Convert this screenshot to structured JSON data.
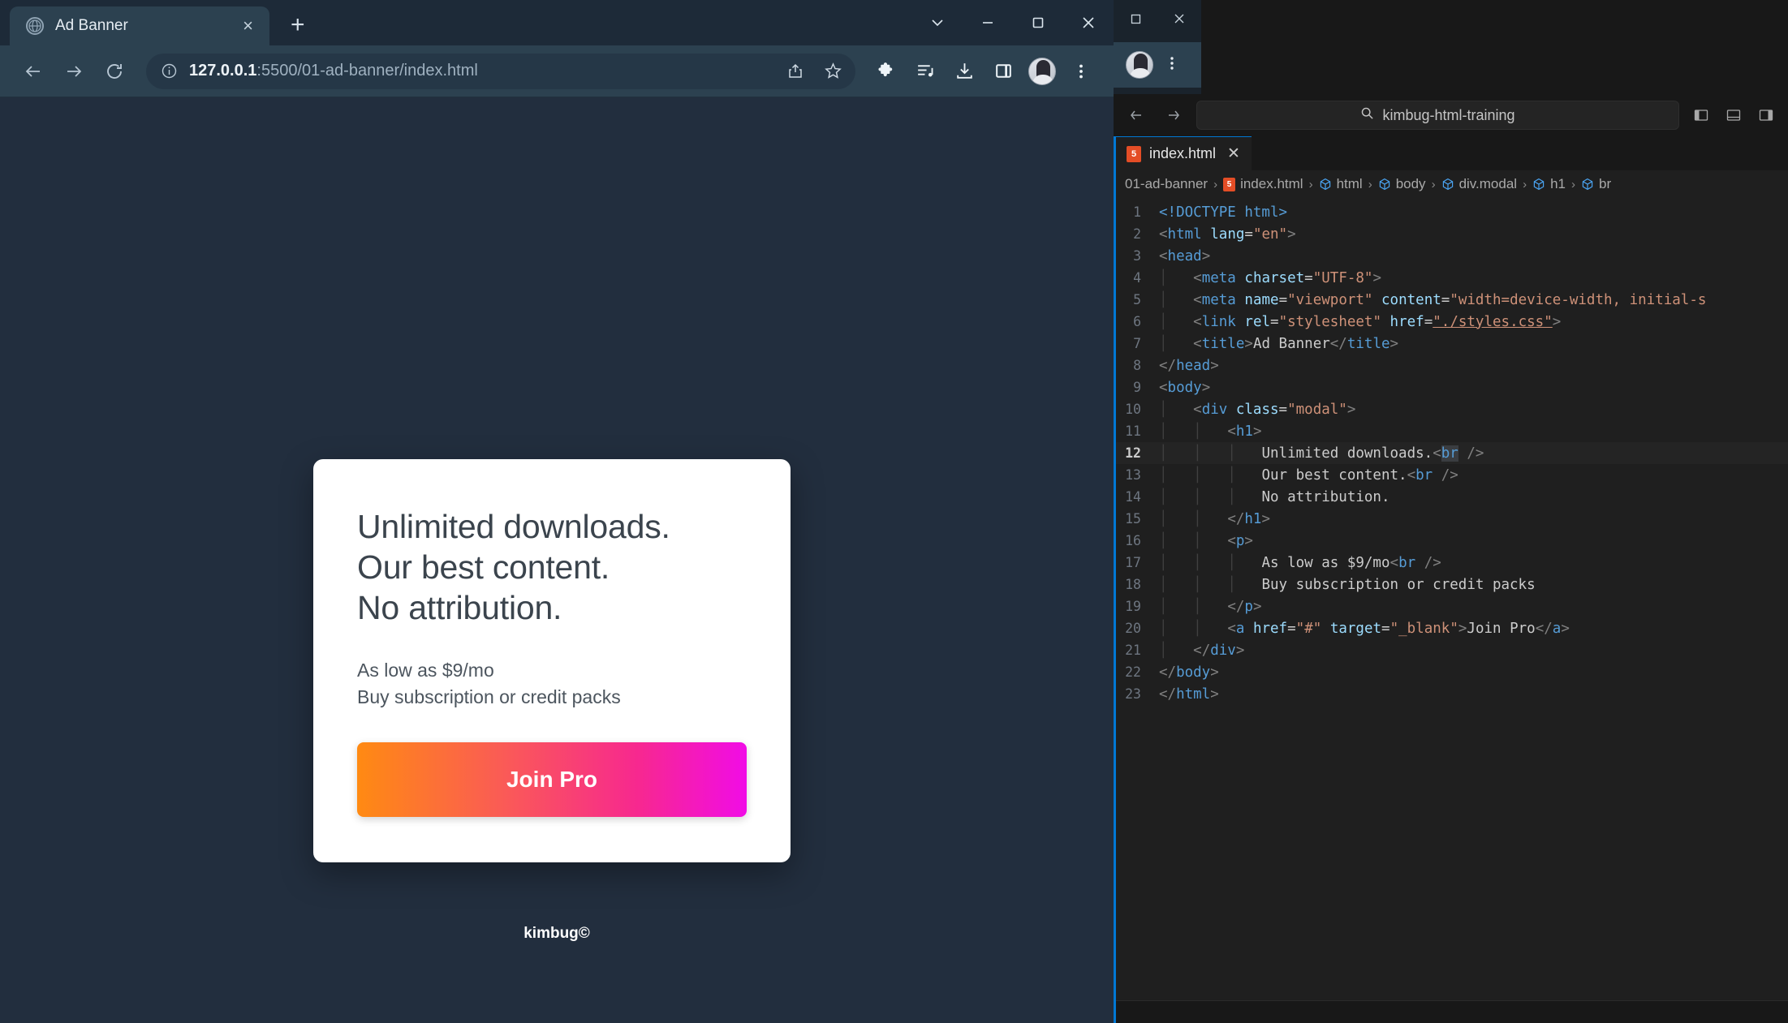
{
  "browser": {
    "tab": {
      "title": "Ad Banner",
      "favicon": "globe-icon",
      "close": "×"
    },
    "new_tab_label": "+",
    "window_controls": {
      "minimize": "–",
      "maximize": "□",
      "close": "✕",
      "tab_search": "⌄"
    },
    "toolbar": {
      "back": "back-arrow-icon",
      "forward": "forward-arrow-icon",
      "reload": "reload-icon",
      "url_prefix": "127.0.0.1",
      "url_suffix": ":5500/01-ad-banner/index.html",
      "url_full": "127.0.0.1:5500/01-ad-banner/index.html",
      "info_icon": "site-info-icon",
      "share_icon": "share-icon",
      "bookmark_icon": "star-icon",
      "extensions_icon": "puzzle-icon",
      "reading_list_icon": "media-list-icon",
      "downloads_icon": "download-icon",
      "side_panel_icon": "side-panel-icon",
      "profile_icon": "avatar",
      "menu_icon": "kebab-menu-icon"
    }
  },
  "page": {
    "heading_line1": "Unlimited downloads.",
    "heading_line2": "Our best content.",
    "heading_line3": "No attribution.",
    "sub_line1": "As low as $9/mo",
    "sub_line2": "Buy subscription or credit packs",
    "cta_label": "Join Pro",
    "credit": "kimbug©",
    "colors": {
      "background": "#222e3e",
      "card": "#ffffff",
      "cta_gradient_start": "#ff8a12",
      "cta_gradient_end": "#f10ce6",
      "heading_text": "#3b444d"
    }
  },
  "vscode": {
    "window_controls": {
      "restore": "❐",
      "close": "✕"
    },
    "profile_icon": "avatar",
    "more_icon": "kebab-menu-icon",
    "quick_input": {
      "value": "kimbug-html-training",
      "search_icon": "search-icon"
    },
    "back_forward": {
      "back": "←",
      "forward": "→"
    },
    "layout_icons": [
      "toggle-primary-sidebar-icon",
      "toggle-panel-icon",
      "toggle-secondary-sidebar-icon"
    ],
    "tab": {
      "label": "index.html",
      "icon": "html5-icon",
      "icon_text": "5",
      "close": "✕"
    },
    "breadcrumb": [
      {
        "label": "01-ad-banner",
        "icon": "none"
      },
      {
        "label": "index.html",
        "icon": "html5-icon"
      },
      {
        "label": "html",
        "icon": "symbol-cube-icon"
      },
      {
        "label": "body",
        "icon": "symbol-cube-icon"
      },
      {
        "label": "div.modal",
        "icon": "symbol-cube-icon"
      },
      {
        "label": "h1",
        "icon": "symbol-cube-icon"
      },
      {
        "label": "br",
        "icon": "symbol-cube-icon"
      }
    ],
    "breadcrumb_separator": "›",
    "active_line": 12,
    "code": [
      {
        "n": 1,
        "indent": 0,
        "tokens": [
          [
            "t-doctype",
            "<!DOCTYPE "
          ],
          [
            "t-tag",
            "html"
          ],
          [
            "t-doctype",
            ">"
          ]
        ]
      },
      {
        "n": 2,
        "indent": 0,
        "tokens": [
          [
            "t-punc",
            "<"
          ],
          [
            "t-tag",
            "html"
          ],
          [
            "t-txt",
            " "
          ],
          [
            "t-attr",
            "lang"
          ],
          [
            "t-txt",
            "="
          ],
          [
            "t-str",
            "\"en\""
          ],
          [
            "t-punc",
            ">"
          ]
        ]
      },
      {
        "n": 3,
        "indent": 0,
        "tokens": [
          [
            "t-punc",
            "<"
          ],
          [
            "t-tag",
            "head"
          ],
          [
            "t-punc",
            ">"
          ]
        ]
      },
      {
        "n": 4,
        "indent": 1,
        "tokens": [
          [
            "t-punc",
            "<"
          ],
          [
            "t-tag",
            "meta"
          ],
          [
            "t-txt",
            " "
          ],
          [
            "t-attr",
            "charset"
          ],
          [
            "t-txt",
            "="
          ],
          [
            "t-str",
            "\"UTF-8\""
          ],
          [
            "t-punc",
            ">"
          ]
        ]
      },
      {
        "n": 5,
        "indent": 1,
        "tokens": [
          [
            "t-punc",
            "<"
          ],
          [
            "t-tag",
            "meta"
          ],
          [
            "t-txt",
            " "
          ],
          [
            "t-attr",
            "name"
          ],
          [
            "t-txt",
            "="
          ],
          [
            "t-str",
            "\"viewport\""
          ],
          [
            "t-txt",
            " "
          ],
          [
            "t-attr",
            "content"
          ],
          [
            "t-txt",
            "="
          ],
          [
            "t-str",
            "\"width=device-width, initial-s"
          ]
        ]
      },
      {
        "n": 6,
        "indent": 1,
        "tokens": [
          [
            "t-punc",
            "<"
          ],
          [
            "t-tag",
            "link"
          ],
          [
            "t-txt",
            " "
          ],
          [
            "t-attr",
            "rel"
          ],
          [
            "t-txt",
            "="
          ],
          [
            "t-str",
            "\"stylesheet\""
          ],
          [
            "t-txt",
            " "
          ],
          [
            "t-attr",
            "href"
          ],
          [
            "t-txt",
            "="
          ],
          [
            "t-str underline-link",
            "\"./styles.css\""
          ],
          [
            "t-punc",
            ">"
          ]
        ]
      },
      {
        "n": 7,
        "indent": 1,
        "tokens": [
          [
            "t-punc",
            "<"
          ],
          [
            "t-tag",
            "title"
          ],
          [
            "t-punc",
            ">"
          ],
          [
            "t-txt",
            "Ad Banner"
          ],
          [
            "t-punc",
            "</"
          ],
          [
            "t-tag",
            "title"
          ],
          [
            "t-punc",
            ">"
          ]
        ]
      },
      {
        "n": 8,
        "indent": 0,
        "tokens": [
          [
            "t-punc",
            "</"
          ],
          [
            "t-tag",
            "head"
          ],
          [
            "t-punc",
            ">"
          ]
        ]
      },
      {
        "n": 9,
        "indent": 0,
        "tokens": [
          [
            "t-punc",
            "<"
          ],
          [
            "t-tag",
            "body"
          ],
          [
            "t-punc",
            ">"
          ]
        ]
      },
      {
        "n": 10,
        "indent": 1,
        "tokens": [
          [
            "t-punc",
            "<"
          ],
          [
            "t-tag",
            "div"
          ],
          [
            "t-txt",
            " "
          ],
          [
            "t-attr",
            "class"
          ],
          [
            "t-txt",
            "="
          ],
          [
            "t-str",
            "\"modal\""
          ],
          [
            "t-punc",
            ">"
          ]
        ]
      },
      {
        "n": 11,
        "indent": 2,
        "tokens": [
          [
            "t-punc",
            "<"
          ],
          [
            "t-tag",
            "h1"
          ],
          [
            "t-punc",
            ">"
          ]
        ]
      },
      {
        "n": 12,
        "indent": 3,
        "tokens": [
          [
            "t-txt",
            "Unlimited downloads."
          ],
          [
            "t-punc",
            "<"
          ],
          [
            "sel t-tag",
            "br"
          ],
          [
            "t-txt",
            " "
          ],
          [
            "t-punc",
            "/>"
          ]
        ]
      },
      {
        "n": 13,
        "indent": 3,
        "tokens": [
          [
            "t-txt",
            "Our best content."
          ],
          [
            "t-punc",
            "<"
          ],
          [
            "t-tag",
            "br"
          ],
          [
            "t-txt",
            " "
          ],
          [
            "t-punc",
            "/>"
          ]
        ]
      },
      {
        "n": 14,
        "indent": 3,
        "tokens": [
          [
            "t-txt",
            "No attribution."
          ]
        ]
      },
      {
        "n": 15,
        "indent": 2,
        "tokens": [
          [
            "t-punc",
            "</"
          ],
          [
            "t-tag",
            "h1"
          ],
          [
            "t-punc",
            ">"
          ]
        ]
      },
      {
        "n": 16,
        "indent": 2,
        "tokens": [
          [
            "t-punc",
            "<"
          ],
          [
            "t-tag",
            "p"
          ],
          [
            "t-punc",
            ">"
          ]
        ]
      },
      {
        "n": 17,
        "indent": 3,
        "tokens": [
          [
            "t-txt",
            "As low as $9/mo"
          ],
          [
            "t-punc",
            "<"
          ],
          [
            "t-tag",
            "br"
          ],
          [
            "t-txt",
            " "
          ],
          [
            "t-punc",
            "/>"
          ]
        ]
      },
      {
        "n": 18,
        "indent": 3,
        "tokens": [
          [
            "t-txt",
            "Buy subscription or credit packs"
          ]
        ]
      },
      {
        "n": 19,
        "indent": 2,
        "tokens": [
          [
            "t-punc",
            "</"
          ],
          [
            "t-tag",
            "p"
          ],
          [
            "t-punc",
            ">"
          ]
        ]
      },
      {
        "n": 20,
        "indent": 2,
        "tokens": [
          [
            "t-punc",
            "<"
          ],
          [
            "t-tag",
            "a"
          ],
          [
            "t-txt",
            " "
          ],
          [
            "t-attr",
            "href"
          ],
          [
            "t-txt",
            "="
          ],
          [
            "t-str",
            "\"#\""
          ],
          [
            "t-txt",
            " "
          ],
          [
            "t-attr",
            "target"
          ],
          [
            "t-txt",
            "="
          ],
          [
            "t-str",
            "\"_blank\""
          ],
          [
            "t-punc",
            ">"
          ],
          [
            "t-txt",
            "Join Pro"
          ],
          [
            "t-punc",
            "</"
          ],
          [
            "t-tag",
            "a"
          ],
          [
            "t-punc",
            ">"
          ]
        ]
      },
      {
        "n": 21,
        "indent": 1,
        "tokens": [
          [
            "t-punc",
            "</"
          ],
          [
            "t-tag",
            "div"
          ],
          [
            "t-punc",
            ">"
          ]
        ]
      },
      {
        "n": 22,
        "indent": 0,
        "tokens": [
          [
            "t-punc",
            "</"
          ],
          [
            "t-tag",
            "body"
          ],
          [
            "t-punc",
            ">"
          ]
        ]
      },
      {
        "n": 23,
        "indent": 0,
        "tokens": [
          [
            "t-punc",
            "</"
          ],
          [
            "t-tag",
            "html"
          ],
          [
            "t-punc",
            ">"
          ]
        ]
      }
    ]
  }
}
